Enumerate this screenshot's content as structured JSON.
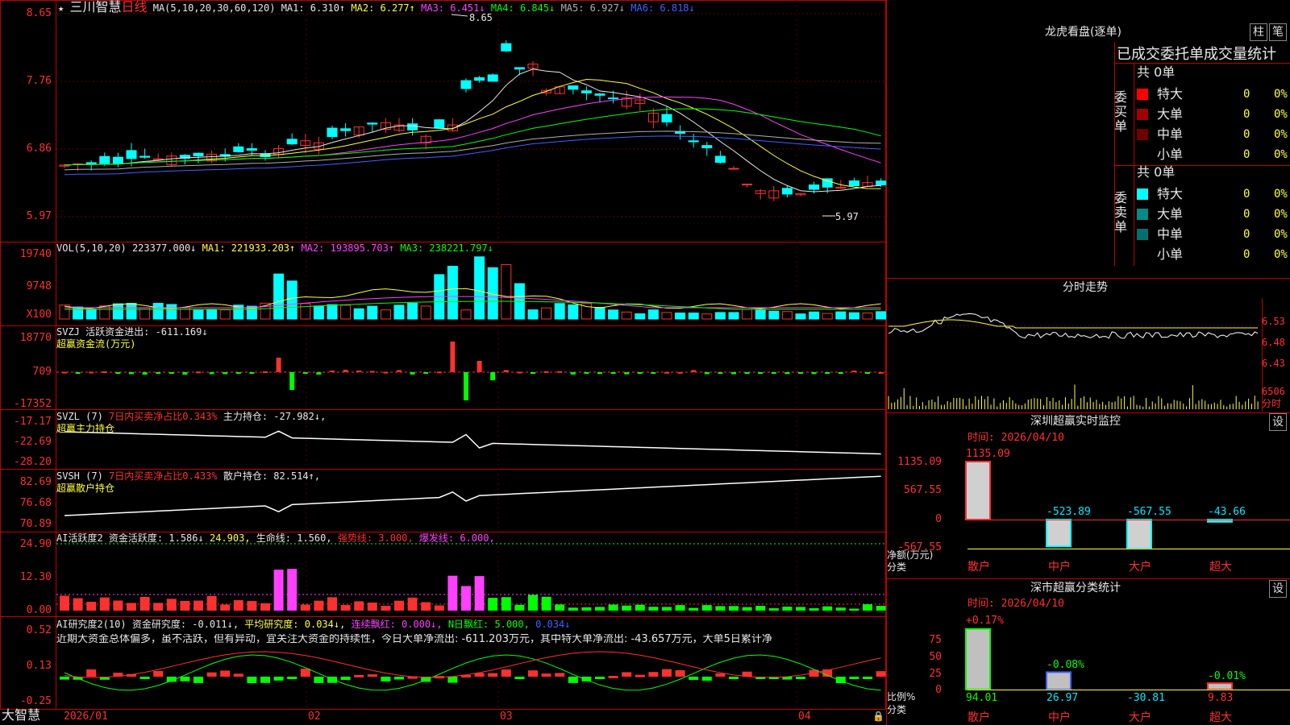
{
  "main_header": {
    "star": "★",
    "name": "三川智慧",
    "period": "日线",
    "ma_params": "MA(5,10,20,30,60,120)",
    "ma1": "MA1: 6.310↑",
    "ma2": "MA2: 6.277↑",
    "ma3": "MA3: 6.451↓",
    "ma4": "MA4: 6.845↓",
    "ma5": "MA5: 6.927↓",
    "ma6": "MA6: 6.818↓"
  },
  "price_axis": [
    "8.65",
    "7.76",
    "6.86",
    "5.97"
  ],
  "price_high_note": "8.65",
  "price_low_note": "5.97",
  "vol_header": {
    "params": "VOL(5,10,20)",
    "value": "223377.000↓",
    "ma1": "MA1: 221933.203↑",
    "ma2": "MA2: 193895.703↑",
    "ma3": "MA3: 238221.797↓"
  },
  "vol_axis": [
    "19740",
    "9748",
    "X100"
  ],
  "svzj": {
    "line1": "SVZJ  活跃资金进出: -611.169↓",
    "title": "超赢资金流(万元)",
    "axis": [
      "18770",
      "709",
      "-17352"
    ]
  },
  "svzl": {
    "params": "SVZL (7)",
    "ratio": "7日内买卖净占比0.343%",
    "hold": "主力持仓: -27.982↓,",
    "title": "超赢主力持仓",
    "axis": [
      "-17.17",
      "-22.69",
      "-28.20"
    ]
  },
  "svsh": {
    "params": "SVSH (7)",
    "ratio": "7日内买卖净占比0.433%",
    "hold": "散户持仓: 82.514↑,",
    "title": "超赢散户持仓",
    "axis": [
      "82.69",
      "76.68",
      "70.89"
    ]
  },
  "ai_active": {
    "params": "AI活跃度2",
    "a": "资金活跃度: 1.586↓",
    "b": "24.903,",
    "c": "生命线: 1.560,",
    "d": "强势线: 3.000,",
    "e": "爆发线: 6.000,",
    "axis": [
      "24.90",
      "12.30",
      "0.00"
    ]
  },
  "ai_research": {
    "params": "AI研究度2(10)",
    "a": "资金研究度: -0.011↓,",
    "b": "平均研究度: 0.034↓,",
    "c": "连续飘红: 0.000↓,",
    "d": "N日飘红: 5.000,",
    "e": "0.034↓",
    "comment": "近期大资金总体偏多，虽不活跃，但有异动，宜关注大资金的持续性，今日大单净流出: -611.203万元，其中特大单净流出: -43.657万元，大单5日累计净",
    "axis": [
      "0.52",
      "0.13",
      "-0.25"
    ]
  },
  "date_axis": [
    "2026/01",
    "02",
    "03",
    "04"
  ],
  "logo": "大智慧",
  "right": {
    "title": "龙虎看盘(逐单)",
    "btn_zhu": "柱",
    "btn_bi": "笔",
    "section_title": "已成交委托单成交量统计",
    "buy_label": "委买单",
    "buy_total": "共 0单",
    "sell_label": "委卖单",
    "sell_total": "共 0单",
    "buy_rows": [
      {
        "name": "特大",
        "count": "0",
        "pct": "0%",
        "color": "#ff0000"
      },
      {
        "name": "大单",
        "count": "0",
        "pct": "0%",
        "color": "#a00000"
      },
      {
        "name": "中单",
        "count": "0",
        "pct": "0%",
        "color": "#700000"
      },
      {
        "name": "小单",
        "count": "0",
        "pct": "0%",
        "color": "#000000"
      }
    ],
    "sell_rows": [
      {
        "name": "特大",
        "count": "0",
        "pct": "0%",
        "color": "#00ffff"
      },
      {
        "name": "大单",
        "count": "0",
        "pct": "0%",
        "color": "#008b8b"
      },
      {
        "name": "中单",
        "count": "0",
        "pct": "0%",
        "color": "#007070"
      },
      {
        "name": "小单",
        "count": "0",
        "pct": "0%",
        "color": "#000000"
      }
    ],
    "minute_title": "分时走势",
    "minute_axis": [
      "6.53",
      "6.48",
      "6.43",
      "6506",
      "分时"
    ],
    "monitor_title": "深圳超赢实时监控",
    "monitor_btn": "设",
    "monitor_time": "时间: 2026/04/10",
    "monitor_axis": [
      "1135.09",
      "567.55",
      "0",
      "-567.55"
    ],
    "monitor_unit1": "净额(万元)",
    "monitor_unit2": "分类",
    "monitor_bars": [
      {
        "cat": "散户",
        "label": "1135.09",
        "value": 1135.09
      },
      {
        "cat": "中户",
        "label": "-523.89",
        "value": -523.89
      },
      {
        "cat": "大户",
        "label": "-567.55",
        "value": -567.55
      },
      {
        "cat": "超大",
        "label": "-43.66",
        "value": -43.66
      }
    ],
    "class_title": "深市超赢分类统计",
    "class_btn": "设",
    "class_time": "时间: 2026/04/10",
    "class_axis": [
      "75",
      "50",
      "25",
      "0"
    ],
    "class_unit1": "比例%",
    "class_unit2": "分类",
    "class_bars": [
      {
        "cat": "散户",
        "top": "+0.17%",
        "bottom": "94.01",
        "value": 94.01
      },
      {
        "cat": "中户",
        "top": "-0.08%",
        "bottom": "26.97",
        "value": 26.97
      },
      {
        "cat": "大户",
        "top": "",
        "bottom": "-30.81",
        "value": -30.81
      },
      {
        "cat": "超大",
        "top": "-0.01%",
        "bottom": "9.83",
        "value": 9.83
      }
    ]
  },
  "colors": {
    "up": "#ff3030",
    "down": "#00ffff",
    "frame": "#c00000"
  }
}
